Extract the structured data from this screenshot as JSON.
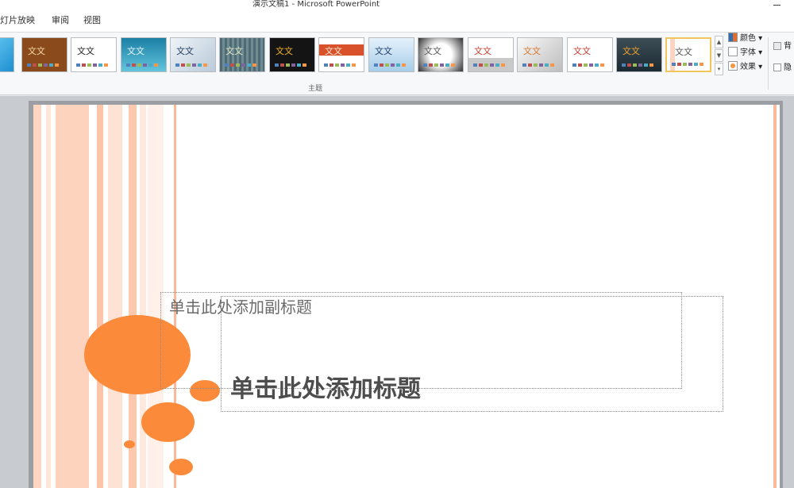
{
  "window": {
    "title": "演示文稿1 - Microsoft PowerPoint"
  },
  "menu": {
    "tabs": [
      {
        "label": "灯片放映"
      },
      {
        "label": "审阅"
      },
      {
        "label": "视图"
      }
    ]
  },
  "ribbon": {
    "group_label": "主题",
    "themes": [
      {
        "text": ""
      },
      {
        "text": "文文"
      },
      {
        "text": "文文"
      },
      {
        "text": "文文"
      },
      {
        "text": "文文"
      },
      {
        "text": "文文"
      },
      {
        "text": "文文"
      },
      {
        "text": "文文"
      },
      {
        "text": "文文"
      },
      {
        "text": "文文"
      },
      {
        "text": "文文"
      },
      {
        "text": "文文"
      },
      {
        "text": "文文"
      },
      {
        "text": "文文"
      },
      {
        "text": "文文"
      }
    ],
    "theme_options": {
      "colors": "颜色",
      "fonts": "字体",
      "effects": "效果"
    },
    "background": {
      "styles_label": "背",
      "hide_label": "隐"
    }
  },
  "slide": {
    "subtitle_placeholder": "单击此处添加副标题",
    "title_placeholder": "单击此处添加标题"
  }
}
